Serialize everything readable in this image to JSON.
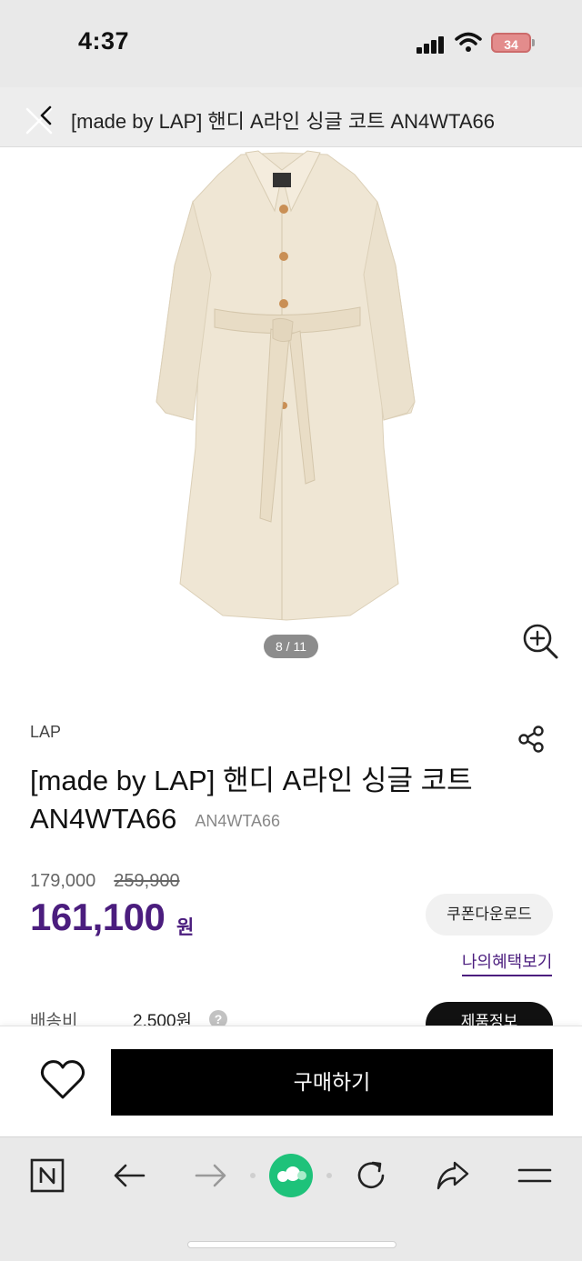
{
  "status_bar": {
    "time": "4:37",
    "battery": "34"
  },
  "header": {
    "title": "[made by LAP] 핸디 A라인 싱글 코트 AN4WTA66"
  },
  "gallery": {
    "page_indicator": "8 / 11"
  },
  "product": {
    "brand": "LAP",
    "name": "[made by LAP] 핸디 A라인 싱글 코트 AN4WTA66",
    "code": "AN4WTA66",
    "price": "179,000",
    "original_price": "259,900",
    "sale_price": "161,100",
    "sale_unit": "원",
    "coupon_label": "쿠폰다운로드",
    "benefit_label": "나의혜택보기",
    "shipping_label": "배송비",
    "shipping_value": "2,500원",
    "info_button_label": "제품정보"
  },
  "purchase_bar": {
    "buy_label": "구매하기"
  },
  "colors": {
    "accent": "#4b1d7e",
    "buy_button": "#000000",
    "coat": "#efe6d4"
  },
  "icons": [
    "close-icon",
    "back-icon",
    "zoom-icon",
    "share-icon",
    "heart-icon",
    "naver-home-icon",
    "back-arrow-icon",
    "forward-arrow-icon",
    "green-dot-icon",
    "refresh-icon",
    "share-arrow-icon",
    "menu-icon"
  ]
}
